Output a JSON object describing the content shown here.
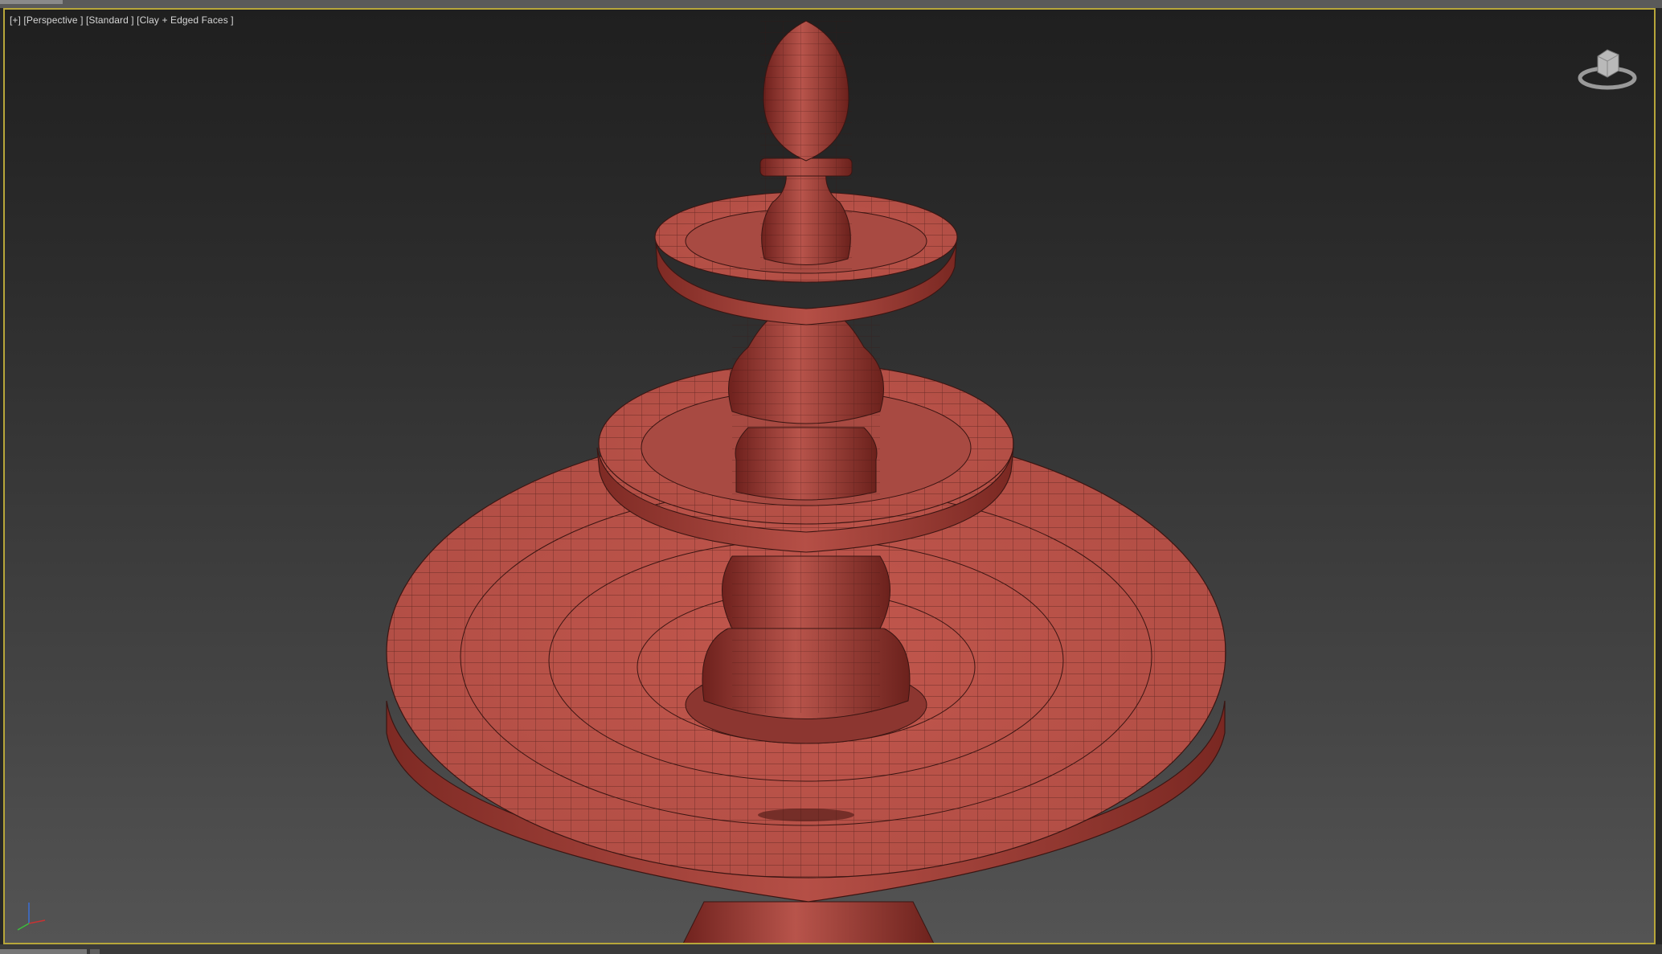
{
  "viewport": {
    "label": "[+] [Perspective ] [Standard ] [Clay + Edged Faces ]",
    "border_color": "#b7a63a"
  },
  "model": {
    "color": "#b14d45",
    "edge_color": "#3a1512"
  },
  "icons": {
    "viewcube": "viewcube-icon",
    "axis": "axis-tripod-icon"
  }
}
